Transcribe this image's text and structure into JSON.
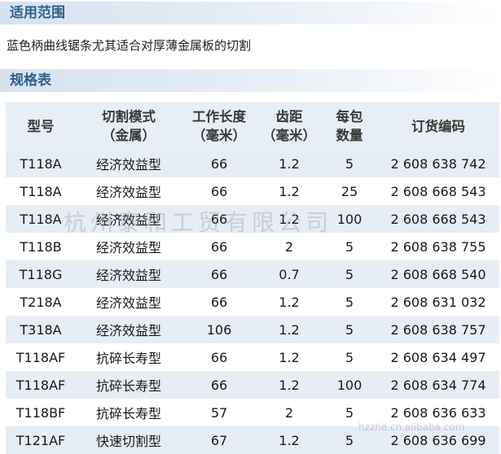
{
  "scope": {
    "title": "适用范围",
    "description": "蓝色柄曲线锯条尤其适合对厚薄金属板的切割"
  },
  "spec": {
    "title": "规格表",
    "columns": [
      [
        "型号"
      ],
      [
        "切割模式",
        "（金属）"
      ],
      [
        "工作长度",
        "（毫米）"
      ],
      [
        "齿距",
        "（毫米）"
      ],
      [
        "每包",
        "数量"
      ],
      [
        "订货编码"
      ]
    ],
    "rows": [
      [
        "T118A",
        "经济效益型",
        "66",
        "1.2",
        "5",
        "2 608 638 742"
      ],
      [
        "T118A",
        "经济效益型",
        "66",
        "1.2",
        "25",
        "2 608 668 543"
      ],
      [
        "T118A",
        "经济效益型",
        "66",
        "1.2",
        "100",
        "2 608 668 543"
      ],
      [
        "T118B",
        "经济效益型",
        "66",
        "2",
        "5",
        "2 608 638 755"
      ],
      [
        "T118G",
        "经济效益型",
        "66",
        "0.7",
        "5",
        "2 608 668 540"
      ],
      [
        "T218A",
        "经济效益型",
        "66",
        "1.2",
        "5",
        "2 608 631 032"
      ],
      [
        "T318A",
        "经济效益型",
        "106",
        "1.2",
        "5",
        "2 608 638 757"
      ],
      [
        "T118AF",
        "抗碎长寿型",
        "66",
        "1.2",
        "5",
        "2 608 634 497"
      ],
      [
        "T118AF",
        "抗碎长寿型",
        "66",
        "1.2",
        "100",
        "2 608 634 774"
      ],
      [
        "T118BF",
        "抗碎长寿型",
        "57",
        "2",
        "5",
        "2 608 636 633"
      ],
      [
        "T121AF",
        "快速切割型",
        "67",
        "1.2",
        "5",
        "2 608 636 699"
      ]
    ]
  },
  "watermarks": {
    "main": "杭州泰和工贸有限公司",
    "url": "hzzhe.cn.alibaba.com"
  }
}
